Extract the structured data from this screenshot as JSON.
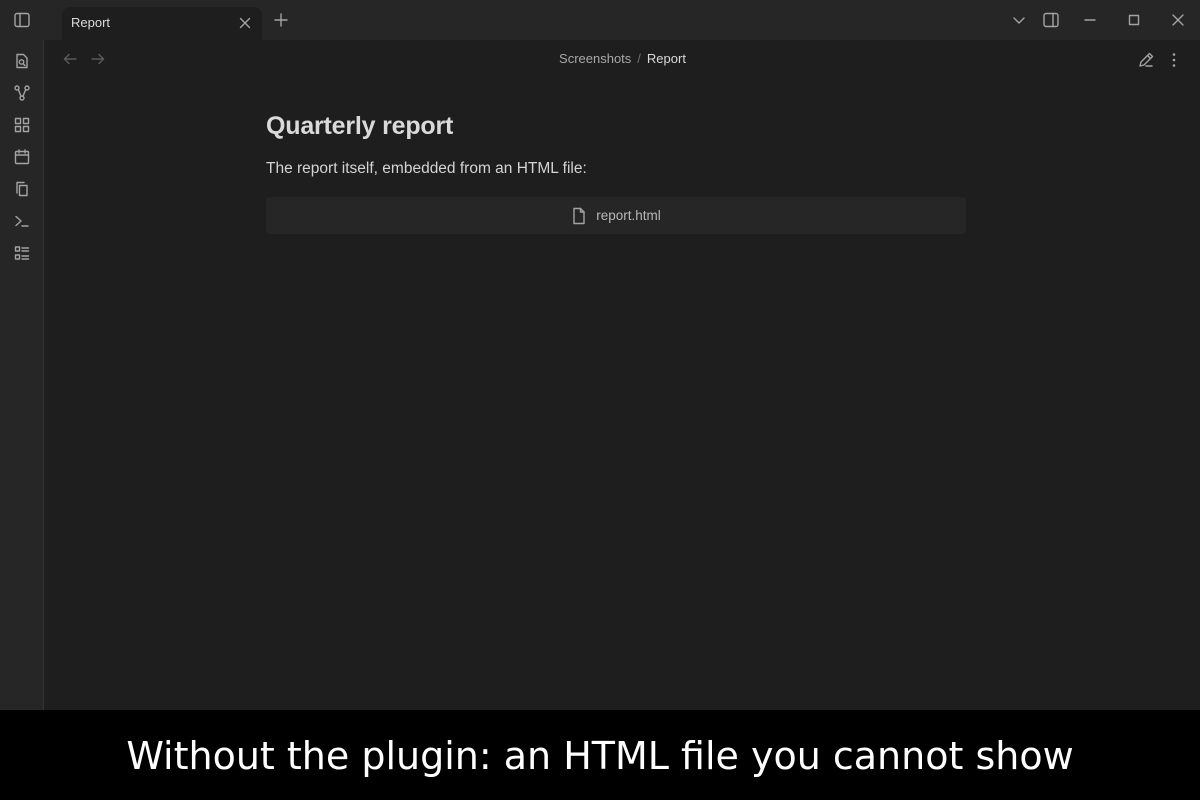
{
  "tab": {
    "title": "Report"
  },
  "breadcrumb": {
    "parent": "Screenshots",
    "separator": "/",
    "current": "Report"
  },
  "note": {
    "title": "Quarterly report",
    "text": "The report itself, embedded from an HTML file:",
    "embed": {
      "file_name": "report.html"
    }
  },
  "caption": "Without the plugin: an HTML file you cannot show",
  "icons": {
    "ribbon": [
      "quick-switcher-icon",
      "graph-view-icon",
      "canvas-icon",
      "daily-note-icon",
      "templates-icon",
      "command-palette-icon",
      "bases-icon"
    ],
    "titlebar": [
      "sidebar-toggle-icon",
      "close-icon",
      "plus-icon",
      "chevron-down-icon",
      "right-sidebar-toggle-icon",
      "minimize-icon",
      "maximize-icon",
      "window-close-icon"
    ],
    "header": [
      "arrow-left-icon",
      "arrow-right-icon",
      "edit-pencil-icon",
      "more-options-icon"
    ],
    "embed": "file-icon"
  },
  "colors": {
    "background": "#1e1e1e",
    "chrome": "#262626",
    "caption_bg": "#000000",
    "caption_text": "#ffffff"
  }
}
